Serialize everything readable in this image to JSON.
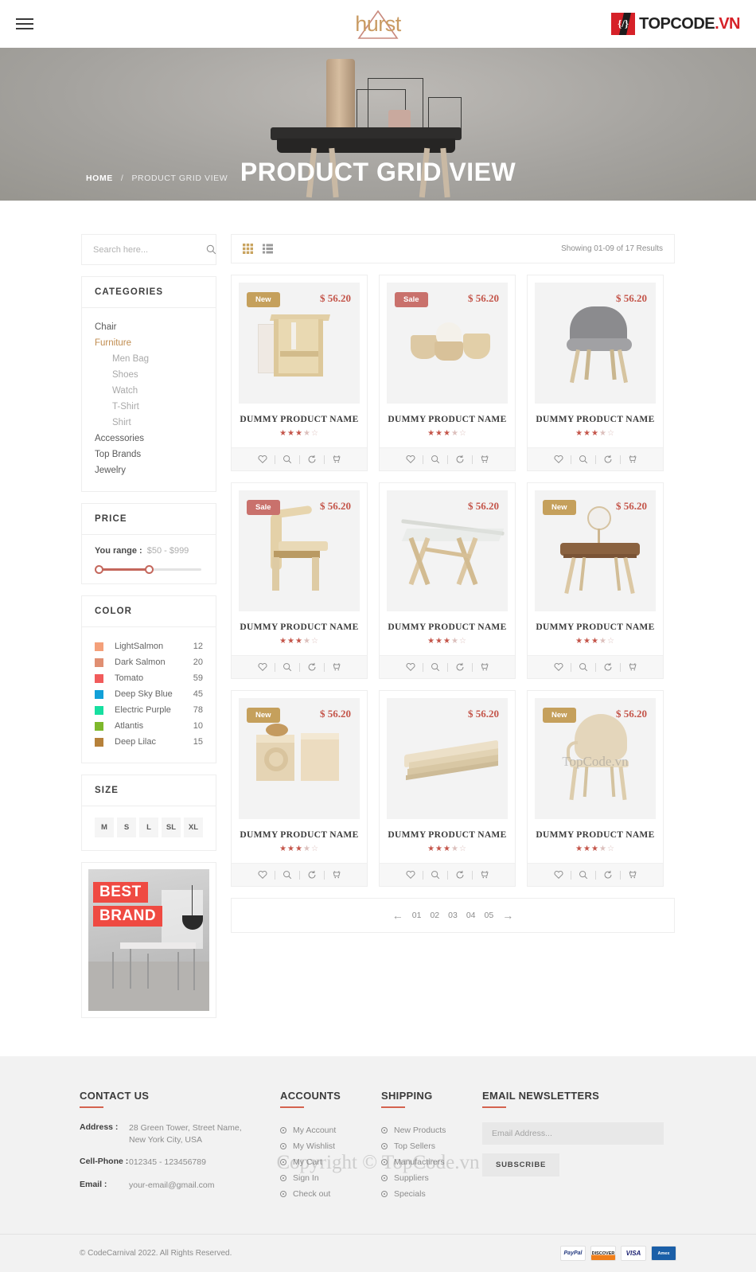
{
  "header": {
    "menu_icon": "hamburger-icon",
    "brand": "hurst",
    "partner_logo": {
      "prefix": "TOPCODE",
      "suffix": ".VN",
      "mark": "{/}"
    }
  },
  "banner": {
    "title": "PRODUCT GRID VIEW",
    "breadcrumb": {
      "home": "HOME",
      "separator": "/",
      "current": "PRODUCT GRID VIEW"
    }
  },
  "sidebar": {
    "search": {
      "placeholder": "Search here...",
      "value": "",
      "icon": "search-icon"
    },
    "categories": {
      "title": "CATEGORIES",
      "items": [
        {
          "label": "Chair",
          "sub": false,
          "active": false
        },
        {
          "label": "Furniture",
          "sub": false,
          "active": true
        },
        {
          "label": "Men Bag",
          "sub": true,
          "active": false
        },
        {
          "label": "Shoes",
          "sub": true,
          "active": false
        },
        {
          "label": "Watch",
          "sub": true,
          "active": false
        },
        {
          "label": "T-Shirt",
          "sub": true,
          "active": false
        },
        {
          "label": "Shirt",
          "sub": true,
          "active": false
        },
        {
          "label": "Accessories",
          "sub": false,
          "active": false
        },
        {
          "label": "Top Brands",
          "sub": false,
          "active": false
        },
        {
          "label": "Jewelry",
          "sub": false,
          "active": false
        }
      ]
    },
    "price": {
      "title": "PRICE",
      "range_label": "You range :",
      "range_value": "$50 - $999",
      "min": 50,
      "max": 999,
      "accent": "#c4675c"
    },
    "color": {
      "title": "COLOR",
      "items": [
        {
          "name": "LightSalmon",
          "count": "12",
          "hex": "#f4a07a"
        },
        {
          "name": "Dark Salmon",
          "count": "20",
          "hex": "#e08f72"
        },
        {
          "name": "Tomato",
          "count": "59",
          "hex": "#f15b5b"
        },
        {
          "name": "Deep Sky Blue",
          "count": "45",
          "hex": "#12a0d8"
        },
        {
          "name": "Electric Purple",
          "count": "78",
          "hex": "#17dfa0"
        },
        {
          "name": "Atlantis",
          "count": "10",
          "hex": "#7eb82c"
        },
        {
          "name": "Deep Lilac",
          "count": "15",
          "hex": "#b6813a"
        }
      ]
    },
    "size": {
      "title": "SIZE",
      "items": [
        "M",
        "S",
        "L",
        "SL",
        "XL"
      ]
    },
    "brand_banner": {
      "line1": "BEST",
      "line2": "BRAND",
      "tag_color": "#ef4a42"
    }
  },
  "toolbar": {
    "grid_view_icon": "grid-view-icon",
    "list_view_icon": "list-view-icon",
    "results_text": "Showing 01-09 of 17 Results"
  },
  "products": [
    {
      "badge": "New",
      "badge_type": "new",
      "price": "$ 56.20",
      "name": "DUMMY PRODUCT NAME",
      "rating": 3.5,
      "art": "stool",
      "watermark": ""
    },
    {
      "badge": "Sale",
      "badge_type": "sale",
      "price": "$ 56.20",
      "name": "DUMMY PRODUCT NAME",
      "rating": 3.5,
      "art": "bowls",
      "watermark": ""
    },
    {
      "badge": "",
      "badge_type": "",
      "price": "$ 56.20",
      "name": "DUMMY PRODUCT NAME",
      "rating": 3.5,
      "art": "greychair",
      "watermark": ""
    },
    {
      "badge": "Sale",
      "badge_type": "sale",
      "price": "$ 56.20",
      "name": "DUMMY PRODUCT NAME",
      "rating": 3.5,
      "art": "woodchair",
      "watermark": ""
    },
    {
      "badge": "",
      "badge_type": "",
      "price": "$ 56.20",
      "name": "DUMMY PRODUCT NAME",
      "rating": 3.5,
      "art": "glasstable",
      "watermark": ""
    },
    {
      "badge": "New",
      "badge_type": "new",
      "price": "$ 56.20",
      "name": "DUMMY PRODUCT NAME",
      "rating": 3.5,
      "art": "vanity",
      "watermark": ""
    },
    {
      "badge": "New",
      "badge_type": "new",
      "price": "$ 56.20",
      "name": "DUMMY PRODUCT NAME",
      "rating": 3.5,
      "art": "blocks",
      "watermark": ""
    },
    {
      "badge": "",
      "badge_type": "",
      "price": "$ 56.20",
      "name": "DUMMY PRODUCT NAME",
      "rating": 3.5,
      "art": "tray",
      "watermark": ""
    },
    {
      "badge": "New",
      "badge_type": "new",
      "price": "$ 56.20",
      "name": "DUMMY PRODUCT NAME",
      "rating": 3.5,
      "art": "armchair",
      "watermark": "TopCode.vn"
    }
  ],
  "card_actions": [
    {
      "icon": "wishlist-heart-icon",
      "label": "Wishlist"
    },
    {
      "icon": "quickview-search-icon",
      "label": "Quick view"
    },
    {
      "icon": "compare-refresh-icon",
      "label": "Compare"
    },
    {
      "icon": "add-to-cart-icon",
      "label": "Add to cart"
    }
  ],
  "pagination": {
    "prev_icon": "arrow-left-icon",
    "next_icon": "arrow-right-icon",
    "pages": [
      "01",
      "02",
      "03",
      "04",
      "05"
    ],
    "active": "01"
  },
  "footer": {
    "contact": {
      "title": "CONTACT US",
      "rows": [
        {
          "key": "Address :",
          "value": "28 Green Tower, Street Name,\nNew York City, USA"
        },
        {
          "key": "Cell-Phone :",
          "value": "012345 - 123456789"
        },
        {
          "key": "Email :",
          "value": "your-email@gmail.com"
        }
      ]
    },
    "accounts": {
      "title": "ACCOUNTS",
      "items": [
        "My Account",
        "My Wishlist",
        "My Cart",
        "Sign In",
        "Check out"
      ]
    },
    "shipping": {
      "title": "SHIPPING",
      "items": [
        "New Products",
        "Top Sellers",
        "Manufactirers",
        "Suppliers",
        "Specials"
      ]
    },
    "newsletter": {
      "title": "EMAIL NEWSLETTERS",
      "placeholder": "Email Address...",
      "value": "",
      "button": "SUBSCRIBE"
    },
    "watermark": "Copyright © TopCode.vn",
    "copyright": "© CodeCarnival 2022. All Rights Reserved.",
    "payments": [
      "PayPal",
      "DISCOVER",
      "VISA",
      "Amex"
    ]
  }
}
